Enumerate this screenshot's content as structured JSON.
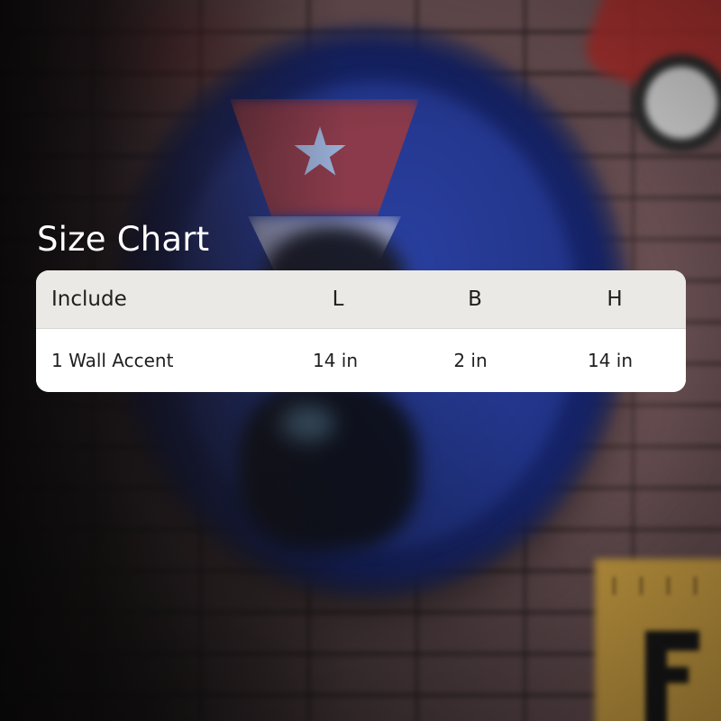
{
  "title": "Size Chart",
  "table": {
    "headers": [
      "Include",
      "L",
      "B",
      "H"
    ],
    "rows": [
      [
        "1 Wall Accent",
        "14 in",
        "2 in",
        "14 in"
      ]
    ]
  },
  "background": {
    "description_icon": "blurred-bottle-cap-wall-decor",
    "colors": {
      "cap_blue": "#1a2c73",
      "brick": "#6a5154",
      "header_row": "#ebe9e5",
      "text": "#1f1f1f"
    }
  }
}
